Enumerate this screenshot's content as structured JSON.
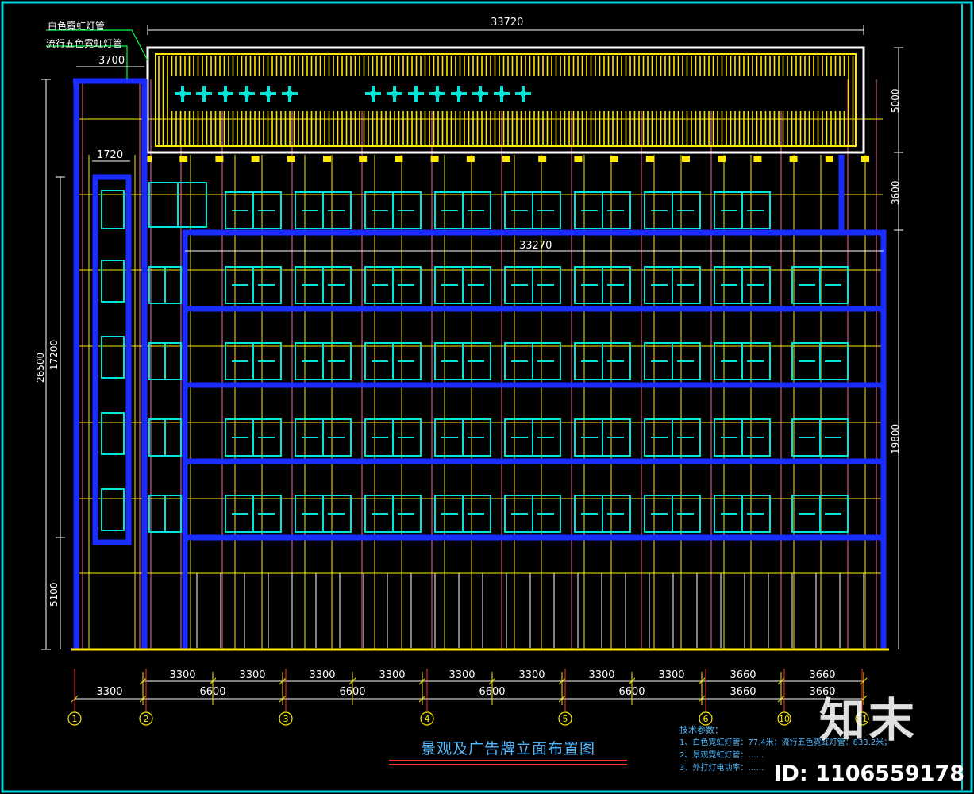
{
  "drawing": {
    "title": "景观及广告牌立面布置图",
    "label_white_neon": "白色霓虹灯管",
    "label_color_neon": "流行五色霓虹灯管",
    "notes_heading": "技术参数：",
    "notes": [
      "1、白色霓虹灯管：77.4米；流行五色霓虹灯管：833.2米；",
      "2、景观霓虹灯管：……",
      "3、外打灯电功率：……"
    ]
  },
  "dimensions": {
    "top_total": "33720",
    "left_width": "3700",
    "small_width": "1720",
    "inner_width": "33270",
    "right_5000": "5000",
    "right_3600": "3600",
    "right_19800": "19800",
    "left_26500": "26500",
    "left_17200": "17200",
    "left_5100": "5100"
  },
  "bottom_dims": {
    "row1": [
      "3300",
      "3300",
      "3300",
      "3300",
      "3300",
      "3300",
      "3300",
      "3300",
      "3660",
      "3660"
    ],
    "row2": [
      "3300",
      "6600",
      "6600",
      "6600",
      "6600",
      "3660",
      "3660"
    ]
  },
  "axes": [
    "1",
    "2",
    "3",
    "4",
    "5",
    "6",
    "10",
    "11"
  ],
  "watermark": {
    "logo": "知末",
    "id": "ID: 1106559178"
  },
  "colors": {
    "background": "#000000",
    "blue_tube": "#1a2cff",
    "cyan_window": "#00e5d8",
    "yellow": "#ffe900",
    "red": "#ff3030",
    "pink": "#ff66a8",
    "white": "#ffffff",
    "frame": "#00d6e0"
  }
}
